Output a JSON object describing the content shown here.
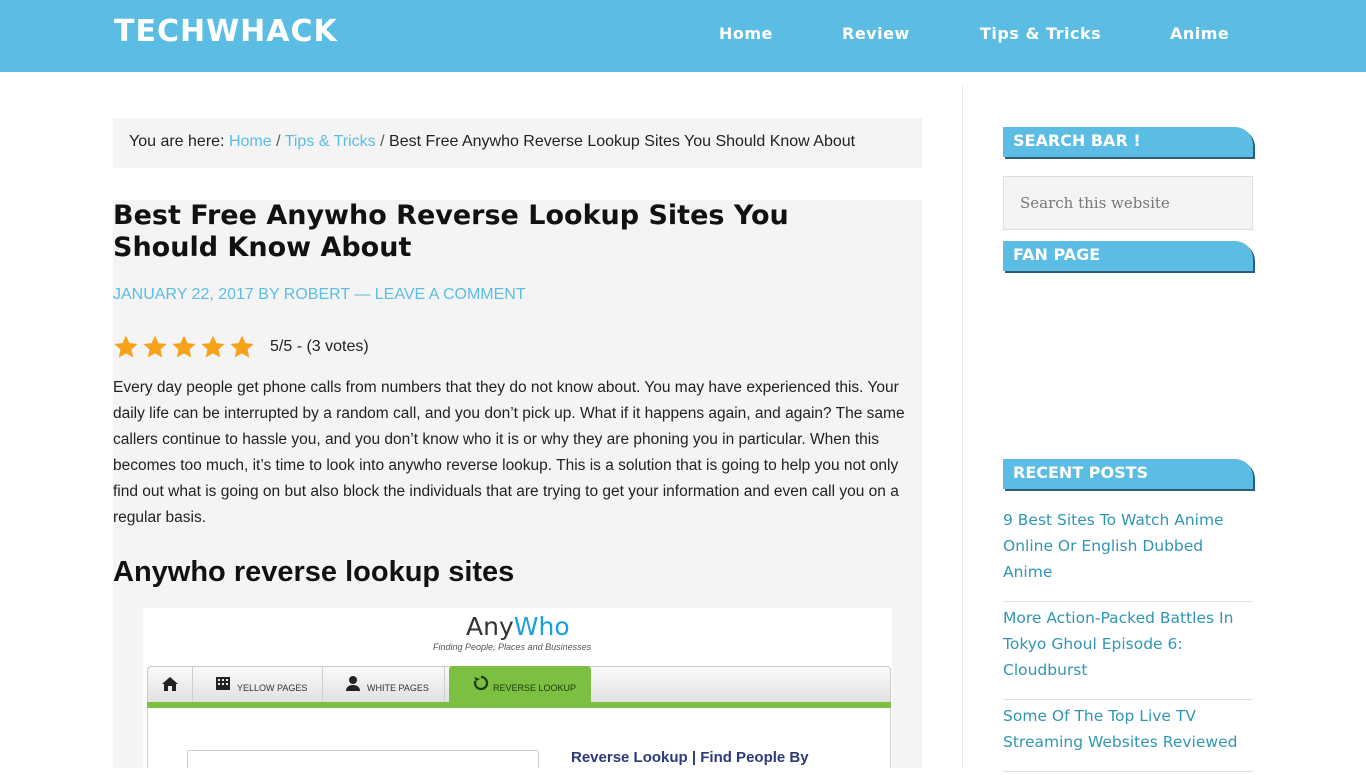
{
  "header": {
    "logo": "TECHWHACK",
    "nav": [
      {
        "label": "Home"
      },
      {
        "label": "Review"
      },
      {
        "label": "Tips & Tricks"
      },
      {
        "label": "Anime"
      }
    ]
  },
  "breadcrumb": {
    "prefix": "You are here:",
    "home": "Home",
    "sep1": "/",
    "category": "Tips & Tricks",
    "sep2": "/",
    "current": "Best Free Anywho Reverse Lookup Sites You Should Know About"
  },
  "article": {
    "title": "Best Free Anywho Reverse Lookup Sites You Should Know About",
    "meta": "JANUARY 22, 2017 BY ROBERT — LEAVE A COMMENT",
    "rating": {
      "stars": 5,
      "max": 5,
      "text": "5/5 - (3 votes)",
      "color": "#f7a21b"
    },
    "body": "Every day people get phone calls from numbers that they do not know about. You may have experienced this. Your daily life can be interrupted by a random call, and you don’t pick up. What if it happens again, and again? The same callers continue to hassle you, and you don’t know who it is or why they are phoning you in particular. When this becomes too much, it’s time to look into anywho reverse lookup. This is a solution that is going to help you not only find out what is going on but also block the individuals that are trying to get your information and even call you on a regular basis.",
    "subheading": "Anywho reverse lookup sites",
    "image": {
      "logo_any": "Any",
      "logo_who": "Who",
      "tagline": "Finding People, Places and Businesses",
      "tabs": [
        {
          "label": "YELLOW PAGES"
        },
        {
          "label": "WHITE PAGES"
        },
        {
          "label": "REVERSE LOOKUP"
        }
      ],
      "panel_heading": "Reverse Lookup | Find People By"
    }
  },
  "sidebar": {
    "search_title": "SEARCH BAR !",
    "search_placeholder": "Search this website",
    "fan_title": "FAN PAGE",
    "recent_title": "RECENT POSTS",
    "recent_posts": [
      "9 Best Sites To Watch Anime Online Or English Dubbed Anime",
      "More Action-Packed Battles In Tokyo Ghoul Episode 6: Cloudburst",
      "Some Of The Top Live TV Streaming Websites Reviewed"
    ]
  },
  "colors": {
    "brand": "#5bbde4",
    "link": "#5bbde4",
    "star": "#f7a21b",
    "anywho_green": "#7cc041"
  }
}
